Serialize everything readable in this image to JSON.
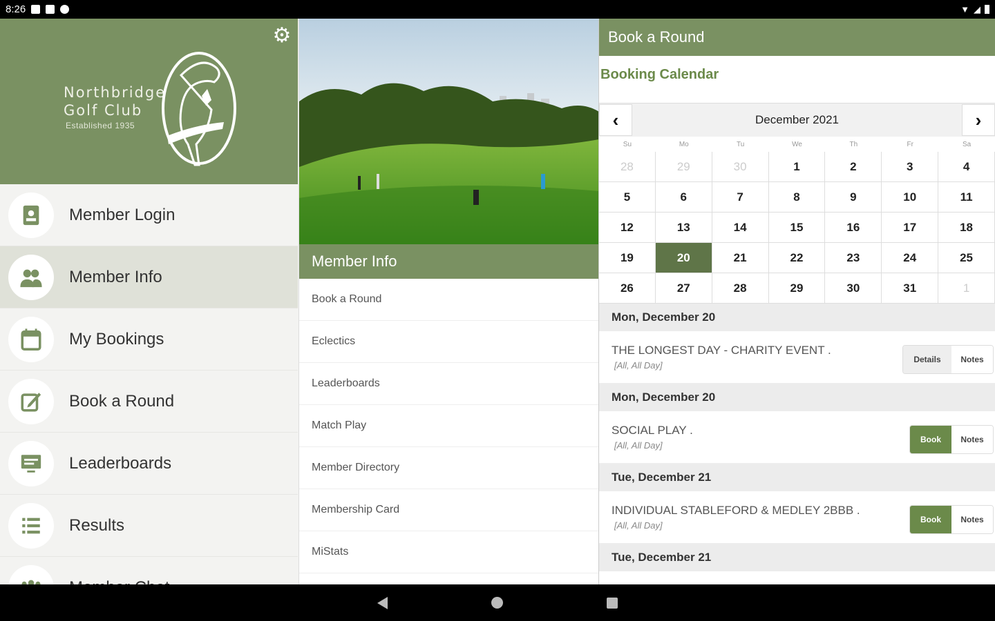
{
  "status_bar": {
    "time": "8:26"
  },
  "club": {
    "name_line1": "Northbridge",
    "name_line2": "Golf Club",
    "established": "Established 1935"
  },
  "menu": [
    {
      "label": "Member Login",
      "icon": "id-badge-icon"
    },
    {
      "label": "Member Info",
      "icon": "members-icon",
      "active": true
    },
    {
      "label": "My Bookings",
      "icon": "calendar-icon"
    },
    {
      "label": "Book a Round",
      "icon": "edit-icon"
    },
    {
      "label": "Leaderboards",
      "icon": "monitor-icon"
    },
    {
      "label": "Results",
      "icon": "list-icon"
    },
    {
      "label": "Member Chat",
      "icon": "group-icon"
    }
  ],
  "member_info": {
    "header": "Member Info",
    "items": [
      "Book a Round",
      "Eclectics",
      "Leaderboards",
      "Match Play",
      "Member Directory",
      "Membership Card",
      "MiStats"
    ]
  },
  "book": {
    "header": "Book a Round",
    "subtitle": "Booking Calendar",
    "month": "December 2021",
    "dow": [
      "Su",
      "Mo",
      "Tu",
      "We",
      "Th",
      "Fr",
      "Sa"
    ],
    "weeks": [
      [
        "28",
        "29",
        "30",
        "1",
        "2",
        "3",
        "4"
      ],
      [
        "5",
        "6",
        "7",
        "8",
        "9",
        "10",
        "11"
      ],
      [
        "12",
        "13",
        "14",
        "15",
        "16",
        "17",
        "18"
      ],
      [
        "19",
        "20",
        "21",
        "22",
        "23",
        "24",
        "25"
      ],
      [
        "26",
        "27",
        "28",
        "29",
        "30",
        "31",
        "1"
      ]
    ],
    "today": "20"
  },
  "events": [
    {
      "date": "Mon, December 20",
      "title": "THE LONGEST DAY - CHARITY EVENT .",
      "sub": "[All, All Day]",
      "btn1": "Details",
      "btn2": "Notes",
      "btn1_style": "grey"
    },
    {
      "date": "Mon, December 20",
      "title": "SOCIAL PLAY .",
      "sub": "[All, All Day]",
      "btn1": "Book",
      "btn2": "Notes",
      "btn1_style": "green"
    },
    {
      "date": "Tue, December 21",
      "title": "INDIVIDUAL STABLEFORD & MEDLEY 2BBB .",
      "sub": "[All, All Day]",
      "btn1": "Book",
      "btn2": "Notes",
      "btn1_style": "green"
    }
  ],
  "trailing_date": "Tue, December 21",
  "colors": {
    "brand_green": "#7a9162",
    "today_green": "#5f7548"
  }
}
